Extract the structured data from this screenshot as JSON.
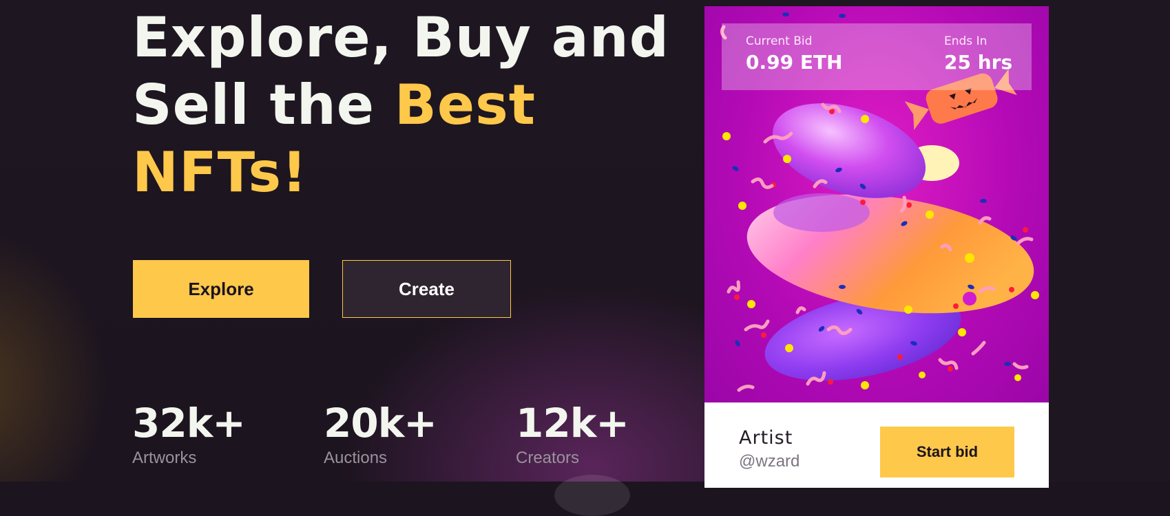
{
  "hero": {
    "line1": "Explore, Buy and",
    "line2_plain": "Sell the ",
    "line2_accent": "Best",
    "line3_accent": "NFTs!"
  },
  "buttons": {
    "explore": "Explore",
    "create": "Create"
  },
  "stats": [
    {
      "value": "32k+",
      "label": "Artworks"
    },
    {
      "value": "20k+",
      "label": "Auctions"
    },
    {
      "value": "12k+",
      "label": "Creators"
    }
  ],
  "card": {
    "current_bid_label": "Current Bid",
    "current_bid_value": "0.99 ETH",
    "ends_in_label": "Ends In",
    "ends_in_value": "25 hrs",
    "artist_name": "Artist",
    "artist_handle": "@wzard",
    "bid_button": "Start bid",
    "art_icon": "nft-artwork-candy"
  },
  "colors": {
    "accent": "#fec84b",
    "background": "#1c141f",
    "text": "#f2f6ee"
  }
}
